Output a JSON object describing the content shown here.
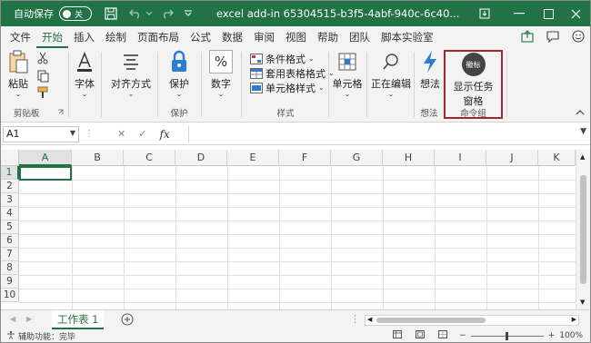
{
  "titlebar": {
    "autosave_label": "自动保存",
    "toggle_state": "关",
    "doc_title": "excel add-in 65304515-b3f5-4abf-940c-6c40..."
  },
  "tabs": [
    "文件",
    "开始",
    "插入",
    "绘制",
    "页面布局",
    "公式",
    "数据",
    "审阅",
    "视图",
    "帮助",
    "团队",
    "脚本实验室"
  ],
  "active_tab": "开始",
  "ribbon": {
    "clipboard": {
      "paste": "粘贴",
      "group": "剪贴板"
    },
    "font": {
      "label": "字体"
    },
    "align": {
      "label": "对齐方式"
    },
    "protect": {
      "label": "保护",
      "group": "保护"
    },
    "number": {
      "label": "数字"
    },
    "styles": {
      "conditional": "条件格式",
      "table": "套用表格格式",
      "cell": "单元格样式",
      "group": "样式"
    },
    "cells": {
      "label": "单元格"
    },
    "editing": {
      "label": "正在编辑"
    },
    "ideas": {
      "label": "想法",
      "group": "想法"
    },
    "command": {
      "badge": "徽标",
      "line1": "显示任务",
      "line2": "窗格",
      "group": "命令组"
    }
  },
  "formula_bar": {
    "name_box": "A1",
    "fx": "fx",
    "value": ""
  },
  "grid": {
    "columns": [
      "A",
      "B",
      "C",
      "D",
      "E",
      "F",
      "G",
      "H",
      "I",
      "J",
      "K"
    ],
    "rows": [
      "1",
      "2",
      "3",
      "4",
      "5",
      "6",
      "7",
      "8",
      "9",
      "10"
    ],
    "selected": "A1"
  },
  "sheets": [
    {
      "name": "工作表 1",
      "active": true
    }
  ],
  "status": {
    "accessibility": "辅助功能：完毕",
    "zoom": "100%"
  },
  "colors": {
    "accent": "#217346",
    "highlight": "#a4262c"
  }
}
